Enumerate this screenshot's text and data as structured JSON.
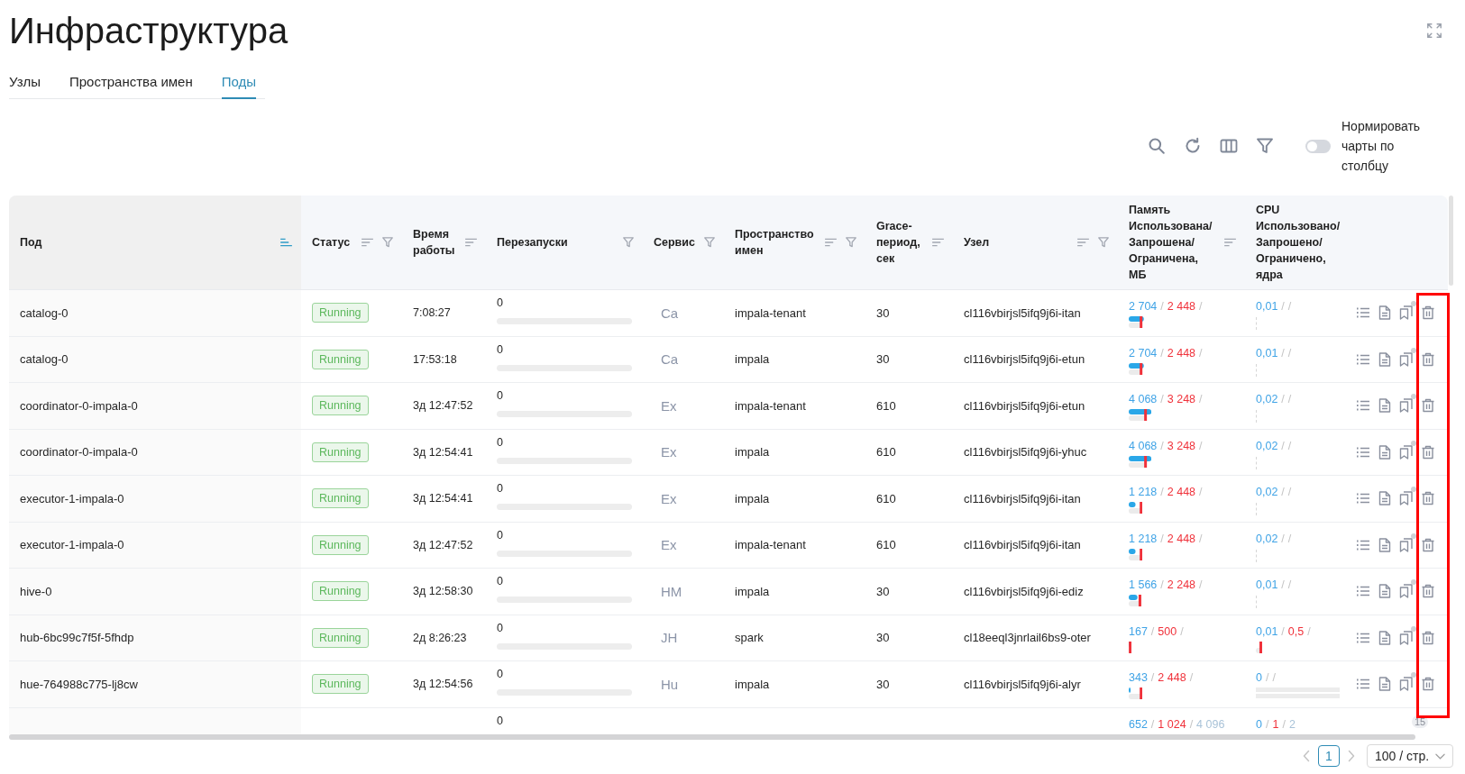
{
  "page": {
    "title": "Инфраструктура"
  },
  "tabs": [
    {
      "label": "Узлы",
      "selected": false
    },
    {
      "label": "Пространства имен",
      "selected": false
    },
    {
      "label": "Поды",
      "selected": true
    }
  ],
  "toolbar": {
    "normalize_toggle": {
      "label": "Нормировать чарты по столбцу",
      "on": false
    }
  },
  "table": {
    "columns": [
      {
        "title": "Под",
        "sortable": true,
        "sorted": true,
        "filterable": false
      },
      {
        "title": "Статус",
        "sortable": true,
        "sorted": false,
        "filterable": true
      },
      {
        "title": "Время работы",
        "sortable": true,
        "sorted": false,
        "filterable": false
      },
      {
        "title": "Перезапуски",
        "sortable": false,
        "sorted": false,
        "filterable": true
      },
      {
        "title": "Сервис",
        "sortable": false,
        "sorted": false,
        "filterable": true
      },
      {
        "title": "Пространство имен",
        "sortable": true,
        "sorted": false,
        "filterable": true
      },
      {
        "title": "Grace-период, сек",
        "sortable": true,
        "sorted": false,
        "filterable": false
      },
      {
        "title": "Узел",
        "sortable": true,
        "sorted": false,
        "filterable": true
      },
      {
        "title": "Память",
        "subtitle": "Использована/Запрошена/Ограничена, МБ",
        "sortable": true,
        "sorted": false,
        "filterable": false
      },
      {
        "title": "CPU",
        "subtitle": "Использовано/Запрошено/Ограничено, ядра",
        "sortable": false,
        "sorted": false,
        "filterable": false
      }
    ],
    "rows": [
      {
        "kind": "pod",
        "name": "catalog-0",
        "status": {
          "text": "Running",
          "kind": "running"
        },
        "uptime": "7:08:27",
        "restarts": {
          "count": "0",
          "bar": {
            "level": 0
          }
        },
        "service": "Ca",
        "namespace": "impala-tenant",
        "grace": "30",
        "node": "cl116vbirjsl5ifq9j6i-itan",
        "memory": {
          "reading": [
            {
              "kind": "used",
              "text": "2 704"
            },
            {
              "kind": "separator",
              "text": "/"
            },
            {
              "kind": "requested",
              "text": "2 448"
            },
            {
              "kind": "separator",
              "text": "/"
            }
          ]
        },
        "cpu": {
          "reading": [
            {
              "kind": "used",
              "text": "0,01"
            },
            {
              "kind": "separator",
              "text": "/"
            },
            {
              "kind": "separator",
              "text": "/"
            }
          ],
          "bar": {
            "kind": "tick"
          }
        }
      },
      {
        "kind": "pod",
        "name": "catalog-0",
        "status": {
          "text": "Running",
          "kind": "running"
        },
        "uptime": "17:53:18",
        "restarts": {
          "count": "0",
          "bar": {
            "level": 0
          }
        },
        "service": "Ca",
        "namespace": "impala",
        "grace": "30",
        "node": "cl116vbirjsl5ifq9j6i-etun",
        "memory": {
          "reading": [
            {
              "kind": "used",
              "text": "2 704"
            },
            {
              "kind": "separator",
              "text": "/"
            },
            {
              "kind": "requested",
              "text": "2 448"
            },
            {
              "kind": "separator",
              "text": "/"
            }
          ]
        },
        "cpu": {
          "reading": [
            {
              "kind": "used",
              "text": "0,01"
            },
            {
              "kind": "separator",
              "text": "/"
            },
            {
              "kind": "separator",
              "text": "/"
            }
          ],
          "bar": {
            "kind": "tick"
          }
        }
      },
      {
        "kind": "pod",
        "name": "coordinator-0-impala-0",
        "status": {
          "text": "Running",
          "kind": "running"
        },
        "uptime": "3д 12:47:52",
        "restarts": {
          "count": "0",
          "bar": {
            "level": 0
          }
        },
        "service": "Ex",
        "namespace": "impala-tenant",
        "grace": "610",
        "node": "cl116vbirjsl5ifq9j6i-etun",
        "memory": {
          "reading": [
            {
              "kind": "used",
              "text": "4 068"
            },
            {
              "kind": "separator",
              "text": "/"
            },
            {
              "kind": "requested",
              "text": "3 248"
            },
            {
              "kind": "separator",
              "text": "/"
            }
          ]
        },
        "cpu": {
          "reading": [
            {
              "kind": "used",
              "text": "0,02"
            },
            {
              "kind": "separator",
              "text": "/"
            },
            {
              "kind": "separator",
              "text": "/"
            }
          ],
          "bar": {
            "kind": "tick"
          }
        }
      },
      {
        "kind": "pod",
        "name": "coordinator-0-impala-0",
        "status": {
          "text": "Running",
          "kind": "running"
        },
        "uptime": "3д 12:54:41",
        "restarts": {
          "count": "0",
          "bar": {
            "level": 0
          }
        },
        "service": "Ex",
        "namespace": "impala",
        "grace": "610",
        "node": "cl116vbirjsl5ifq9j6i-yhuc",
        "memory": {
          "reading": [
            {
              "kind": "used",
              "text": "4 068"
            },
            {
              "kind": "separator",
              "text": "/"
            },
            {
              "kind": "requested",
              "text": "3 248"
            },
            {
              "kind": "separator",
              "text": "/"
            }
          ]
        },
        "cpu": {
          "reading": [
            {
              "kind": "used",
              "text": "0,02"
            },
            {
              "kind": "separator",
              "text": "/"
            },
            {
              "kind": "separator",
              "text": "/"
            }
          ],
          "bar": {
            "kind": "tick"
          }
        }
      },
      {
        "kind": "pod",
        "name": "executor-1-impala-0",
        "status": {
          "text": "Running",
          "kind": "running"
        },
        "uptime": "3д 12:54:41",
        "restarts": {
          "count": "0",
          "bar": {
            "level": 0
          }
        },
        "service": "Ex",
        "namespace": "impala",
        "grace": "610",
        "node": "cl116vbirjsl5ifq9j6i-itan",
        "memory": {
          "reading": [
            {
              "kind": "used",
              "text": "1 218"
            },
            {
              "kind": "separator",
              "text": "/"
            },
            {
              "kind": "requested",
              "text": "2 448"
            },
            {
              "kind": "separator",
              "text": "/"
            }
          ]
        },
        "cpu": {
          "reading": [
            {
              "kind": "used",
              "text": "0,02"
            },
            {
              "kind": "separator",
              "text": "/"
            },
            {
              "kind": "separator",
              "text": "/"
            }
          ],
          "bar": {
            "kind": "tick"
          }
        }
      },
      {
        "kind": "pod",
        "name": "executor-1-impala-0",
        "status": {
          "text": "Running",
          "kind": "running"
        },
        "uptime": "3д 12:47:52",
        "restarts": {
          "count": "0",
          "bar": {
            "level": 0
          }
        },
        "service": "Ex",
        "namespace": "impala-tenant",
        "grace": "610",
        "node": "cl116vbirjsl5ifq9j6i-itan",
        "memory": {
          "reading": [
            {
              "kind": "used",
              "text": "1 218"
            },
            {
              "kind": "separator",
              "text": "/"
            },
            {
              "kind": "requested",
              "text": "2 448"
            },
            {
              "kind": "separator",
              "text": "/"
            }
          ]
        },
        "cpu": {
          "reading": [
            {
              "kind": "used",
              "text": "0,02"
            },
            {
              "kind": "separator",
              "text": "/"
            },
            {
              "kind": "separator",
              "text": "/"
            }
          ],
          "bar": {
            "kind": "tick"
          }
        }
      },
      {
        "kind": "pod",
        "name": "hive-0",
        "status": {
          "text": "Running",
          "kind": "running"
        },
        "uptime": "3д 12:58:30",
        "restarts": {
          "count": "0",
          "bar": {
            "level": 0
          }
        },
        "service": "HM",
        "namespace": "impala",
        "grace": "30",
        "node": "cl116vbirjsl5ifq9j6i-ediz",
        "memory": {
          "reading": [
            {
              "kind": "used",
              "text": "1 566"
            },
            {
              "kind": "separator",
              "text": "/"
            },
            {
              "kind": "requested",
              "text": "2 248"
            },
            {
              "kind": "separator",
              "text": "/"
            }
          ]
        },
        "cpu": {
          "reading": [
            {
              "kind": "used",
              "text": "0,01"
            },
            {
              "kind": "separator",
              "text": "/"
            },
            {
              "kind": "separator",
              "text": "/"
            }
          ],
          "bar": {
            "kind": "tick"
          }
        }
      },
      {
        "kind": "pod",
        "name": "hub-6bc99c7f5f-5fhdp",
        "status": {
          "text": "Running",
          "kind": "running"
        },
        "uptime": "2д 8:26:23",
        "restarts": {
          "count": "0",
          "bar": {
            "level": 0
          }
        },
        "service": "JH",
        "namespace": "spark",
        "grace": "30",
        "node": "cl18eeql3jnrlail6bs9-oter",
        "memory": {
          "reading": [
            {
              "kind": "used",
              "text": "167"
            },
            {
              "kind": "separator",
              "text": "/"
            },
            {
              "kind": "requested",
              "text": "500"
            },
            {
              "kind": "separator",
              "text": "/"
            }
          ]
        },
        "cpu": {
          "reading": [
            {
              "kind": "used",
              "text": "0,01"
            },
            {
              "kind": "separator",
              "text": "/"
            },
            {
              "kind": "requested",
              "text": "0,5"
            },
            {
              "kind": "separator",
              "text": "/"
            }
          ],
          "bar": {
            "kind": "marker"
          }
        }
      },
      {
        "kind": "pod",
        "name": "hue-764988c775-lj8cw",
        "status": {
          "text": "Running",
          "kind": "running"
        },
        "uptime": "3д 12:54:56",
        "restarts": {
          "count": "0",
          "bar": {
            "level": 0
          }
        },
        "service": "Hu",
        "namespace": "impala",
        "grace": "30",
        "node": "cl116vbirjsl5ifq9j6i-alyr",
        "memory": {
          "reading": [
            {
              "kind": "used",
              "text": "343"
            },
            {
              "kind": "separator",
              "text": "/"
            },
            {
              "kind": "requested",
              "text": "2 448"
            },
            {
              "kind": "separator",
              "text": "/"
            }
          ]
        },
        "cpu": {
          "reading": [
            {
              "kind": "used",
              "text": "0"
            },
            {
              "kind": "separator",
              "text": "/"
            },
            {
              "kind": "separator",
              "text": "/"
            }
          ],
          "bar": {
            "kind": "track"
          }
        }
      },
      {
        "kind": "cut",
        "restarts": {
          "count": "0"
        },
        "memory": {
          "reading": [
            {
              "kind": "used",
              "text": "652"
            },
            {
              "kind": "separator",
              "text": "/"
            },
            {
              "kind": "requested",
              "text": "1 024"
            },
            {
              "kind": "separator",
              "text": "/"
            },
            {
              "kind": "limit",
              "text": "4 096"
            }
          ]
        },
        "cpu": {
          "reading": [
            {
              "kind": "used",
              "text": "0"
            },
            {
              "kind": "separator",
              "text": "/"
            },
            {
              "kind": "requested",
              "text": "1"
            },
            {
              "kind": "separator",
              "text": "/"
            },
            {
              "kind": "limit",
              "text": "2"
            }
          ]
        },
        "badge": "15"
      }
    ]
  },
  "annotations": [
    {
      "kind": "frame"
    }
  ],
  "pagination": {
    "previous": {
      "disabled": true
    },
    "pages": [
      {
        "label": "1",
        "selected": true
      }
    ],
    "next": {
      "disabled": true
    },
    "page_size": "100 / стр."
  }
}
